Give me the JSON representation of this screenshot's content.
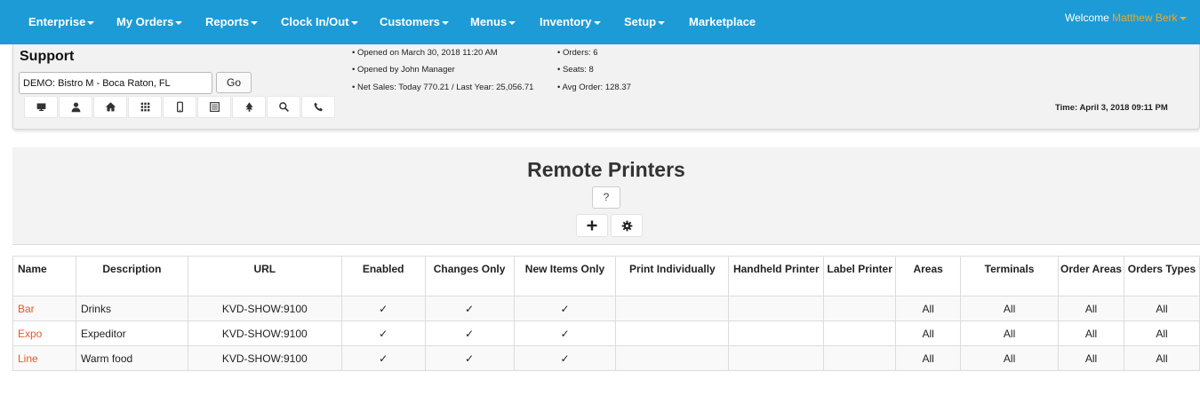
{
  "nav": {
    "items": [
      {
        "label": "Enterprise",
        "caret": true
      },
      {
        "label": "My Orders",
        "caret": true
      },
      {
        "label": "Reports",
        "caret": true
      },
      {
        "label": "Clock In/Out",
        "caret": true
      },
      {
        "label": "Customers",
        "caret": true
      },
      {
        "label": "Menus",
        "caret": true
      },
      {
        "label": "Inventory",
        "caret": true
      },
      {
        "label": "Setup",
        "caret": true
      },
      {
        "label": "Marketplace",
        "caret": false
      }
    ],
    "welcome_label": "Welcome",
    "user_name": "Matthew Berk",
    "brand_color": "#1d9bd6",
    "user_color": "#f5a623"
  },
  "support": {
    "title": "Support",
    "store_value": "DEMO: Bistro M - Boca Raton, FL",
    "go_label": "Go",
    "icons": [
      "monitor-icon",
      "user-icon",
      "home-icon",
      "grid-icon",
      "mobile-icon",
      "list-icon",
      "tree-icon",
      "search-icon",
      "phone-icon"
    ],
    "info_left": [
      "• Opened on March 30, 2018 11:20 AM",
      "• Opened by John Manager",
      "• Net Sales: Today 770.21 / Last Year: 25,056.71"
    ],
    "info_right": [
      "• Orders: 6",
      "• Seats: 8",
      "• Avg Order: 128.37"
    ],
    "time_label": "Time: April 3, 2018 09:11 PM"
  },
  "main": {
    "title": "Remote Printers",
    "help_label": "?",
    "add_icon": "plus-icon",
    "settings_icon": "gear-icon"
  },
  "table": {
    "headers": [
      "Name",
      "Description",
      "URL",
      "Enabled",
      "Changes Only",
      "New Items Only",
      "Print Individually",
      "Handheld Printer",
      "Label Printer",
      "Areas",
      "Terminals",
      "Order Areas",
      "Orders Types"
    ],
    "rows": [
      [
        "Bar",
        "Drinks",
        "KVD-SHOW:9100",
        "✓",
        "✓",
        "✓",
        "",
        "",
        "",
        "All",
        "All",
        "All",
        "All"
      ],
      [
        "Expo",
        "Expeditor",
        "KVD-SHOW:9100",
        "✓",
        "✓",
        "✓",
        "",
        "",
        "",
        "All",
        "All",
        "All",
        "All"
      ],
      [
        "Line",
        "Warm food",
        "KVD-SHOW:9100",
        "✓",
        "✓",
        "✓",
        "",
        "",
        "",
        "All",
        "All",
        "All",
        "All"
      ]
    ],
    "link_color": "#e8572a"
  }
}
